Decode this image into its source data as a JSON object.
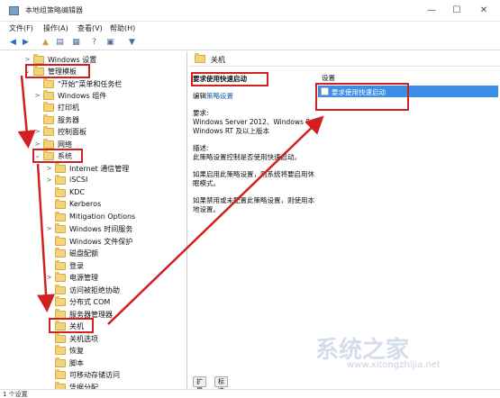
{
  "window": {
    "title": "本地组策略编辑器",
    "controls": {
      "minimize": "—",
      "maximize": "☐",
      "close": "✕"
    }
  },
  "menu": [
    "文件(F)",
    "操作(A)",
    "查看(V)",
    "帮助(H)"
  ],
  "toolbar_icons": [
    "back-icon",
    "forward-icon",
    "up-folder-icon",
    "show-tree-icon",
    "export-list-icon",
    "help-icon",
    "properties-icon",
    "filter-icon"
  ],
  "tree": [
    {
      "label": "Windows 设置",
      "arrow": ">"
    },
    {
      "label": "管理模板",
      "arrow": "⌄"
    },
    {
      "label": "\"开始\"菜单和任务栏",
      "arrow": ""
    },
    {
      "label": "Windows 组件",
      "arrow": ">"
    },
    {
      "label": "打印机",
      "arrow": ""
    },
    {
      "label": "服务器",
      "arrow": ""
    },
    {
      "label": "控制面板",
      "arrow": ">"
    },
    {
      "label": "网络",
      "arrow": ">"
    },
    {
      "label": "系统",
      "arrow": "⌄"
    },
    {
      "label": "Internet 通信管理",
      "arrow": ">"
    },
    {
      "label": "iSCSI",
      "arrow": ">"
    },
    {
      "label": "KDC",
      "arrow": ""
    },
    {
      "label": "Kerberos",
      "arrow": ""
    },
    {
      "label": "Mitigation Options",
      "arrow": ""
    },
    {
      "label": "Windows 时间服务",
      "arrow": ">"
    },
    {
      "label": "Windows 文件保护",
      "arrow": ""
    },
    {
      "label": "磁盘配额",
      "arrow": ""
    },
    {
      "label": "登录",
      "arrow": ""
    },
    {
      "label": "电源管理",
      "arrow": ">"
    },
    {
      "label": "访问被拒绝协助",
      "arrow": ""
    },
    {
      "label": "分布式 COM",
      "arrow": ">"
    },
    {
      "label": "服务器管理器",
      "arrow": ""
    },
    {
      "label": "关机",
      "arrow": ""
    },
    {
      "label": "关机选项",
      "arrow": ""
    },
    {
      "label": "恢复",
      "arrow": ""
    },
    {
      "label": "脚本",
      "arrow": ""
    },
    {
      "label": "可移动存储访问",
      "arrow": ""
    },
    {
      "label": "凭据分配",
      "arrow": ""
    }
  ],
  "right": {
    "header": "关机",
    "policy_title": "要求使用快速启动",
    "edit_prefix": "编辑",
    "edit_link": "策略设置",
    "req_label": "要求:",
    "req_text": "Windows Server 2012、Windows 8 或 Windows RT 及以上版本",
    "desc_label": "描述:",
    "desc_text": "此策略设置控制是否使用快速启动。",
    "enable_text": "如果启用此策略设置，则系统将要启用休眠模式。",
    "disable_text": "如果禁用或未配置此策略设置，则使用本地设置。",
    "setting_header": "设置",
    "setting_item": "要求使用快速启动",
    "tabs": [
      "扩展",
      "标准"
    ]
  },
  "status": "1 个设置",
  "watermark": "系统之家",
  "watermark_sub": "www.xitongzhijia.net",
  "accent_color": "#d21f1f"
}
